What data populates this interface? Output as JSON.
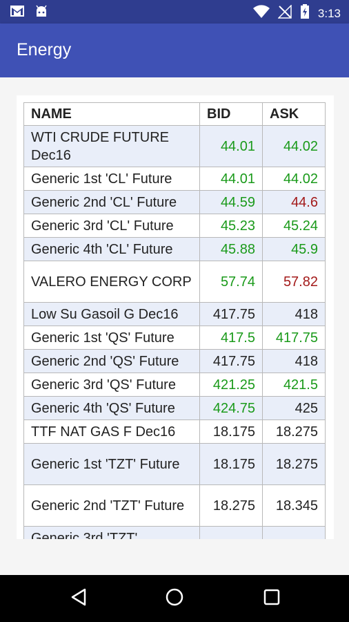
{
  "status_bar": {
    "time": "3:13"
  },
  "app_bar": {
    "title": "Energy"
  },
  "table": {
    "headers": {
      "name": "NAME",
      "bid": "BID",
      "ask": "ASK"
    },
    "rows": [
      {
        "name": "WTI CRUDE FUTURE Dec16",
        "bid": "44.01",
        "ask": "44.02"
      },
      {
        "name": "Generic 1st 'CL' Future",
        "bid": "44.01",
        "ask": "44.02"
      },
      {
        "name": "Generic 2nd 'CL' Future",
        "bid": "44.59",
        "ask": "44.6"
      },
      {
        "name": "Generic 3rd 'CL' Future",
        "bid": "45.23",
        "ask": "45.24"
      },
      {
        "name": "Generic 4th 'CL' Future",
        "bid": "45.88",
        "ask": "45.9"
      },
      {
        "name": "VALERO ENERGY CORP",
        "bid": "57.74",
        "ask": "57.82"
      },
      {
        "name": "Low Su Gasoil G Dec16",
        "bid": "417.75",
        "ask": "418"
      },
      {
        "name": "Generic 1st 'QS' Future",
        "bid": "417.5",
        "ask": "417.75"
      },
      {
        "name": "Generic 2nd 'QS' Future",
        "bid": "417.75",
        "ask": "418"
      },
      {
        "name": "Generic 3rd 'QS' Future",
        "bid": "421.25",
        "ask": "421.5"
      },
      {
        "name": "Generic 4th 'QS' Future",
        "bid": "424.75",
        "ask": "425"
      },
      {
        "name": "TTF NAT GAS F Dec16",
        "bid": "18.175",
        "ask": "18.275"
      },
      {
        "name": "Generic 1st 'TZT' Future",
        "bid": "18.175",
        "ask": "18.275"
      },
      {
        "name": "Generic 2nd 'TZT' Future",
        "bid": "18.275",
        "ask": "18.345"
      },
      {
        "name": "Generic 3rd 'TZT'",
        "bid": "",
        "ask": ""
      }
    ]
  },
  "colors": {
    "up": "#1a9a1a",
    "down": "#a31a1a",
    "appbar": "#3f51b5",
    "statusbar": "#2f3d8f"
  },
  "icons": [
    "gmail-icon",
    "android-icon",
    "wifi-icon",
    "no-signal-icon",
    "battery-charging-icon",
    "back-icon",
    "home-icon",
    "recents-icon"
  ]
}
